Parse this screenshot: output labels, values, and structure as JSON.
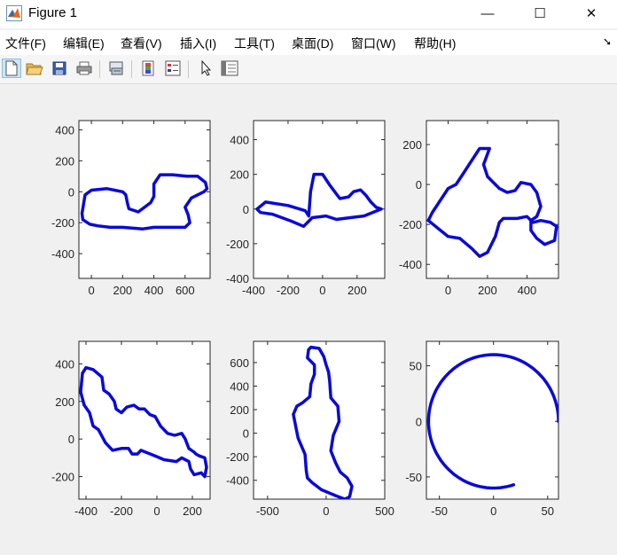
{
  "window": {
    "title": "Figure 1",
    "minimize": "—",
    "maximize": "☐",
    "close": "✕"
  },
  "menu": {
    "items": [
      "文件(F)",
      "编辑(E)",
      "查看(V)",
      "插入(I)",
      "工具(T)",
      "桌面(D)",
      "窗口(W)",
      "帮助(H)"
    ],
    "overflow_icon": "dock-arrow-icon"
  },
  "toolbar": {
    "buttons": [
      "new-figure-icon",
      "open-file-icon",
      "save-icon",
      "print-icon",
      "link-plot-icon",
      "insert-colorbar-icon",
      "insert-legend-icon",
      "edit-plot-cursor-icon",
      "property-inspector-icon"
    ]
  },
  "colors": {
    "line": "#0a0ad6",
    "axes_bg": "#ffffff",
    "figure_bg": "#f0f0f0",
    "text": "#262626"
  },
  "chart_data": [
    {
      "type": "line",
      "xlim": [
        -80,
        760
      ],
      "ylim": [
        -560,
        460
      ],
      "xticks": [
        0,
        200,
        400,
        600
      ],
      "yticks": [
        400,
        200,
        0,
        -200,
        -400
      ],
      "x": [
        -60,
        -40,
        0,
        100,
        200,
        220,
        230,
        240,
        300,
        380,
        400,
        400,
        440,
        520,
        610,
        680,
        730,
        740,
        720,
        640,
        600,
        620,
        630,
        600,
        520,
        400,
        330,
        200,
        120,
        40,
        -10,
        -55,
        -60
      ],
      "y": [
        -140,
        -20,
        10,
        20,
        0,
        -20,
        -70,
        -110,
        -130,
        -70,
        -30,
        50,
        110,
        110,
        100,
        100,
        60,
        20,
        0,
        -40,
        -100,
        -150,
        -200,
        -230,
        -230,
        -230,
        -240,
        -230,
        -230,
        -220,
        -210,
        -180,
        -140
      ]
    },
    {
      "type": "line",
      "xlim": [
        -400,
        360
      ],
      "ylim": [
        -400,
        510
      ],
      "xticks": [
        -400,
        -200,
        0,
        200
      ],
      "yticks": [
        400,
        200,
        0,
        -200,
        -400
      ],
      "x": [
        -380,
        -330,
        -200,
        -100,
        -80,
        -70,
        -50,
        0,
        40,
        100,
        150,
        180,
        220,
        250,
        280,
        310,
        340,
        240,
        160,
        80,
        20,
        -60,
        -110,
        -180,
        -290,
        -360,
        -380
      ],
      "y": [
        0,
        40,
        20,
        -10,
        -40,
        100,
        200,
        200,
        140,
        60,
        70,
        100,
        110,
        80,
        40,
        10,
        0,
        -40,
        -50,
        -60,
        -40,
        -50,
        -100,
        -70,
        -30,
        -20,
        0
      ]
    },
    {
      "type": "line",
      "xlim": [
        -110,
        560
      ],
      "ylim": [
        -470,
        320
      ],
      "xticks": [
        0,
        200,
        400
      ],
      "yticks": [
        200,
        0,
        -200,
        -400
      ],
      "x": [
        -100,
        -80,
        0,
        40,
        80,
        120,
        160,
        210,
        180,
        200,
        260,
        300,
        340,
        370,
        420,
        450,
        470,
        450,
        420,
        420,
        450,
        490,
        540,
        550,
        520,
        470,
        430,
        400,
        350,
        280,
        260,
        240,
        200,
        160,
        120,
        60,
        0,
        -50,
        -100
      ],
      "y": [
        -180,
        -140,
        -20,
        0,
        60,
        120,
        180,
        180,
        100,
        40,
        -20,
        -40,
        -30,
        10,
        0,
        -40,
        -110,
        -160,
        -180,
        -230,
        -270,
        -300,
        -280,
        -210,
        -190,
        -180,
        -190,
        -160,
        -170,
        -170,
        -190,
        -260,
        -340,
        -360,
        -320,
        -270,
        -260,
        -220,
        -180
      ]
    },
    {
      "type": "line",
      "xlim": [
        -440,
        300
      ],
      "ylim": [
        -320,
        520
      ],
      "xticks": [
        -400,
        -200,
        0,
        200
      ],
      "yticks": [
        400,
        200,
        0,
        -200
      ],
      "x": [
        -420,
        -400,
        -360,
        -310,
        -300,
        -270,
        -240,
        -230,
        -200,
        -170,
        -130,
        -100,
        -70,
        -40,
        -10,
        20,
        60,
        100,
        140,
        160,
        180,
        210,
        220,
        240,
        270,
        280,
        270,
        250,
        210,
        190,
        180,
        140,
        110,
        40,
        -10,
        -90,
        -110,
        -140,
        -160,
        -200,
        -250,
        -290,
        -330,
        -360,
        -380,
        -410,
        -430,
        -420
      ],
      "y": [
        350,
        380,
        370,
        330,
        260,
        240,
        200,
        160,
        140,
        170,
        180,
        160,
        160,
        130,
        120,
        70,
        30,
        20,
        30,
        0,
        -50,
        -70,
        -80,
        -90,
        -100,
        -150,
        -200,
        -180,
        -190,
        -160,
        -120,
        -100,
        -120,
        -110,
        -90,
        -60,
        -80,
        -80,
        -50,
        -50,
        -60,
        -20,
        50,
        70,
        140,
        180,
        250,
        350
      ]
    },
    {
      "type": "line",
      "xlim": [
        -620,
        500
      ],
      "ylim": [
        -560,
        780
      ],
      "xticks": [
        -500,
        0,
        500
      ],
      "yticks": [
        600,
        400,
        200,
        0,
        -200,
        -400
      ],
      "x": [
        -130,
        -60,
        -20,
        0,
        20,
        30,
        40,
        100,
        110,
        60,
        40,
        80,
        120,
        180,
        220,
        200,
        160,
        80,
        -40,
        -120,
        -160,
        -170,
        -180,
        -240,
        -280,
        -250,
        -200,
        -140,
        -130,
        -100,
        -100,
        -160,
        -150,
        -130
      ],
      "y": [
        730,
        720,
        650,
        580,
        520,
        440,
        300,
        230,
        100,
        -20,
        -150,
        -250,
        -330,
        -380,
        -450,
        -540,
        -560,
        -530,
        -480,
        -420,
        -380,
        -320,
        -180,
        -40,
        160,
        230,
        260,
        310,
        420,
        500,
        580,
        640,
        710,
        730
      ]
    },
    {
      "type": "line",
      "xlim": [
        -62,
        60
      ],
      "ylim": [
        -70,
        72
      ],
      "xticks": [
        -50,
        0,
        50
      ],
      "yticks": [
        50,
        0,
        -50
      ],
      "arc": {
        "center": [
          0,
          0
        ],
        "radius": 60,
        "start_deg": 0,
        "end_deg": 288
      }
    }
  ]
}
